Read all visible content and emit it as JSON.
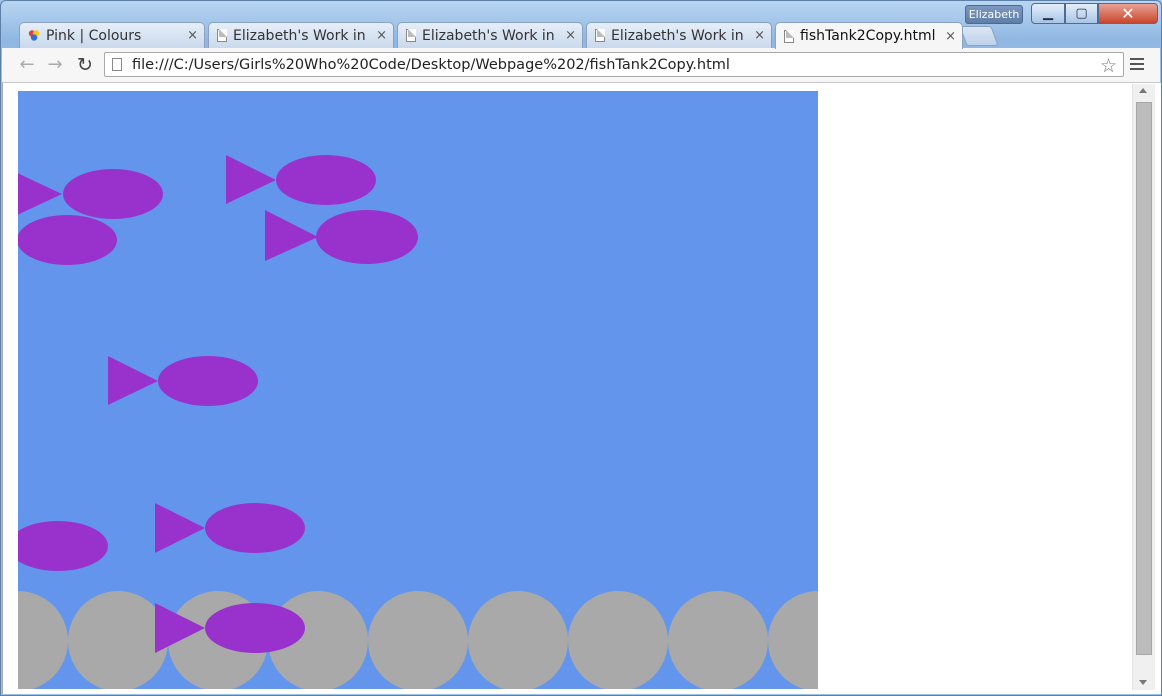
{
  "window": {
    "profile_name": "Elizabeth",
    "minimize_symbol": "▁",
    "maximize_symbol": "▢",
    "close_symbol": "✕"
  },
  "tabs": [
    {
      "title": "Pink | Colours",
      "icon": "colour-wheel-icon",
      "active": false
    },
    {
      "title": "Elizabeth's Work in C",
      "icon": "page-icon",
      "active": false
    },
    {
      "title": "Elizabeth's Work in C",
      "icon": "page-icon",
      "active": false
    },
    {
      "title": "Elizabeth's Work in C",
      "icon": "page-icon",
      "active": false
    },
    {
      "title": "fishTank2Copy.html",
      "icon": "page-icon",
      "active": true
    }
  ],
  "tab_close_symbol": "×",
  "toolbar": {
    "back_symbol": "←",
    "forward_symbol": "→",
    "reload_symbol": "↻",
    "star_symbol": "☆",
    "url": "file:///C:/Users/Girls%20Who%20Code/Desktop/Webpage%202/fishTank2Copy.html"
  },
  "fish_tank": {
    "water_color": "#6495ed",
    "fish_color": "#9932cc",
    "rock_color": "#a9a9a9",
    "fish_count": 8,
    "rock_count": 9
  }
}
